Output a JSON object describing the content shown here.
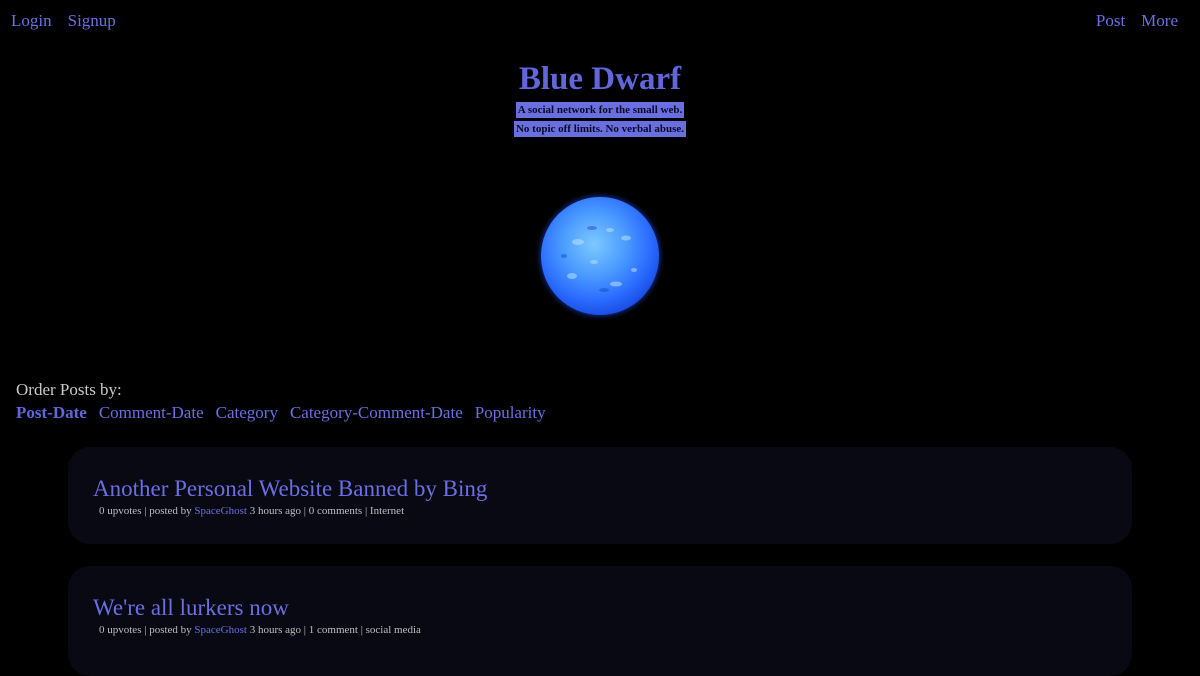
{
  "topnav": {
    "left": [
      {
        "label": "Login"
      },
      {
        "label": "Signup"
      }
    ],
    "right": [
      {
        "label": "Post"
      },
      {
        "label": "More"
      }
    ]
  },
  "header": {
    "title": "Blue Dwarf",
    "taglines": [
      "A social network for the small web.",
      "No topic off limits. No verbal abuse."
    ]
  },
  "order": {
    "label": "Order Posts by:",
    "options": [
      {
        "label": "Post-Date",
        "active": true
      },
      {
        "label": "Comment-Date",
        "active": false
      },
      {
        "label": "Category",
        "active": false
      },
      {
        "label": "Category-Comment-Date",
        "active": false
      },
      {
        "label": "Popularity",
        "active": false
      }
    ]
  },
  "posts": [
    {
      "title": "Another Personal Website Banned by Bing",
      "upvotes": "0 upvotes",
      "posted_by": "posted by",
      "author": "SpaceGhost",
      "time": "3 hours ago",
      "comments": "0 comments",
      "category": "Internet"
    },
    {
      "title": "We're all lurkers now",
      "upvotes": "0 upvotes",
      "posted_by": "posted by",
      "author": "SpaceGhost",
      "time": "3 hours ago",
      "comments": "1 comment",
      "category": "social media"
    }
  ],
  "colors": {
    "background": "#000000",
    "accent": "#6b6fe0",
    "title": "#6166db",
    "card": "#090914",
    "muted_text": "#c8c8c8"
  }
}
